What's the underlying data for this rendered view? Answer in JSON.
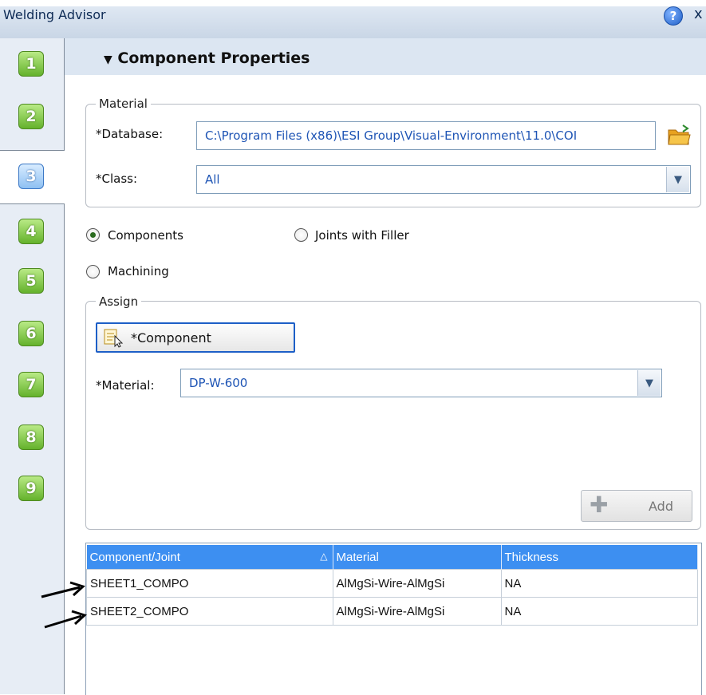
{
  "window": {
    "title": "Welding Advisor",
    "help_icon": "help-icon",
    "help_glyph": "?",
    "close_glyph": "x"
  },
  "steps": [
    "1",
    "2",
    "3",
    "4",
    "5",
    "6",
    "7",
    "8",
    "9"
  ],
  "active_step": "3",
  "section": {
    "title": "Component Properties"
  },
  "material_group": {
    "label": "Material",
    "database_label": "*Database:",
    "database_value": "C:\\Program Files (x86)\\ESI Group\\Visual-Environment\\11.0\\COI",
    "class_label": "*Class:",
    "class_value": "All"
  },
  "radios": {
    "components": "Components",
    "joints_with_filler": "Joints with Filler",
    "machining": "Machining",
    "selected": "Components"
  },
  "assign_group": {
    "label": "Assign",
    "component_button": "*Component",
    "material_label": "*Material:",
    "material_value": "DP-W-600",
    "add_button": "Add"
  },
  "table": {
    "headers": [
      "Component/Joint",
      "Material",
      "Thickness"
    ],
    "rows": [
      [
        "SHEET1_COMPO",
        "AlMgSi-Wire-AlMgSi",
        "NA"
      ],
      [
        "SHEET2_COMPO",
        "AlMgSi-Wire-AlMgSi",
        "NA"
      ]
    ]
  },
  "colors": {
    "step_green": "#64b22b",
    "header_blue": "#3d8ff1",
    "field_text": "#1f55b5"
  }
}
